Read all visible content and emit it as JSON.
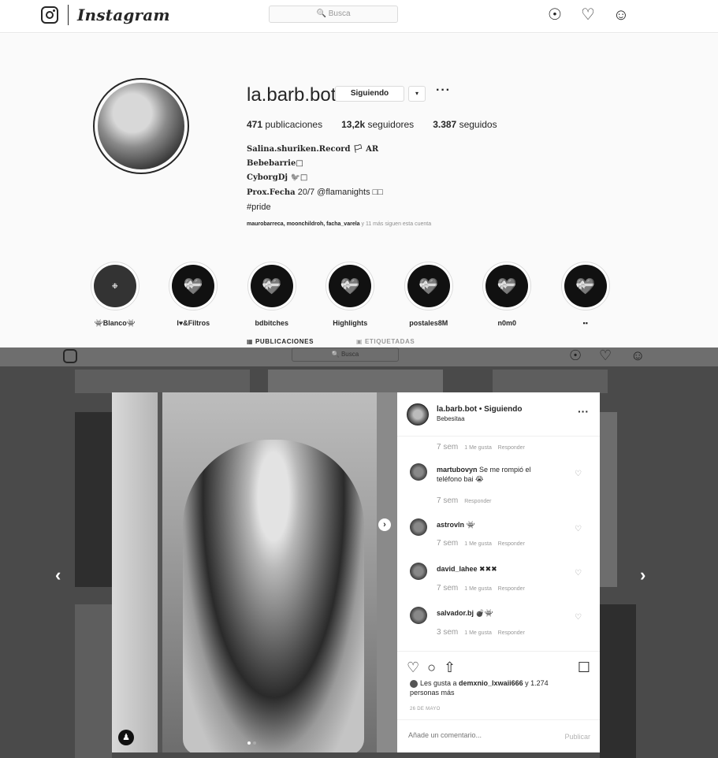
{
  "nav": {
    "wordmark": "Instagram",
    "search_placeholder": "🔍 Busca",
    "icons": [
      "compass-icon",
      "heart-icon",
      "user-icon"
    ]
  },
  "profile": {
    "username": "la.barb.bot",
    "follow_label": "Siguiendo",
    "dropdown_label": "▾",
    "more_label": "···",
    "stats": {
      "posts_num": "471",
      "posts_label": "publicaciones",
      "followers_num": "13,2k",
      "followers_label": "seguidores",
      "following_num": "3.387",
      "following_label": "seguidos"
    },
    "bio": {
      "line1": "Salina.shuriken.Record 🏳 AR",
      "line2": "Bebebarrie□",
      "line3": "CyborgDj 🐦□",
      "line4_prefix": "Prox.Fecha",
      "line4_rest": " 20/7 @flamanights □□",
      "line5": "#pride"
    },
    "followed_by": "maurobarreca, moonchildroh, facha_varela",
    "followed_by_rest": " y 11 más siguen esta cuenta"
  },
  "highlights": [
    {
      "label": "👾Blanco👾",
      "icon": "❉"
    },
    {
      "label": "I♥&Filtros",
      "icon": "💝"
    },
    {
      "label": "bdbitches",
      "icon": "💝"
    },
    {
      "label": "Highlights",
      "icon": "💝"
    },
    {
      "label": "postales8M",
      "icon": "💝"
    },
    {
      "label": "n0m0",
      "icon": "💝"
    },
    {
      "label": "▪▪",
      "icon": "💝"
    }
  ],
  "tabs": {
    "posts": "▦ PUBLICACIONES",
    "tagged": "▣ ETIQUETADAS"
  },
  "modal": {
    "header_user": "la.barb.bot • Siguiendo",
    "header_location": "Bebesitaa",
    "header_more": "···",
    "top_meta": {
      "age": "7 sem",
      "likes": "1 Me gusta",
      "reply": "Responder"
    },
    "comments": [
      {
        "user": "martubovyn",
        "text": " Se me rompió el teléfono bai 😭",
        "age": "7 sem",
        "likes": "",
        "reply": "Responder"
      },
      {
        "user": "astrovln",
        "text": " 👾",
        "age": "7 sem",
        "likes": "1 Me gusta",
        "reply": "Responder"
      },
      {
        "user": "david_lahee",
        "text": " ✖✖✖",
        "age": "7 sem",
        "likes": "1 Me gusta",
        "reply": "Responder"
      },
      {
        "user": "salvador.bj",
        "text": " 💣👾",
        "age": "3 sem",
        "likes": "1 Me gusta",
        "reply": "Responder"
      }
    ],
    "likes_prefix": "Les gusta a ",
    "likes_user": "demxnio_lxwaii666",
    "likes_rest": " y 1.274 personas más",
    "date": "26 DE MAYO",
    "comment_placeholder": "Añade un comentario...",
    "publish": "Publicar"
  }
}
